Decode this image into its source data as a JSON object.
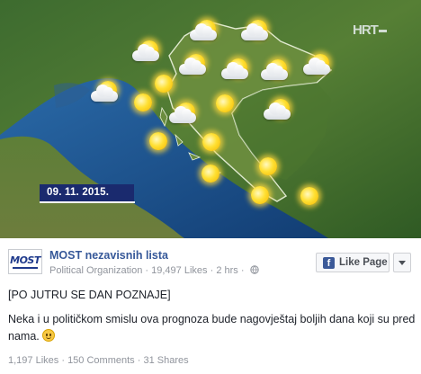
{
  "video": {
    "channel_logo": "HRT",
    "date": "09. 11. 2015."
  },
  "weather_icons": [
    {
      "type": "sun-cloud"
    },
    {
      "type": "sun-cloud"
    },
    {
      "type": "sun-cloud"
    },
    {
      "type": "sun-cloud"
    },
    {
      "type": "sun"
    },
    {
      "type": "sun-cloud"
    },
    {
      "type": "sun-cloud"
    },
    {
      "type": "sun-cloud"
    },
    {
      "type": "sun-cloud"
    },
    {
      "type": "sun"
    },
    {
      "type": "sun-cloud"
    },
    {
      "type": "sun-cloud"
    },
    {
      "type": "sun"
    },
    {
      "type": "sun"
    },
    {
      "type": "sun"
    },
    {
      "type": "sun"
    },
    {
      "type": "sun"
    },
    {
      "type": "sun"
    },
    {
      "type": "sun"
    }
  ],
  "post": {
    "page_logo_text": "MOST",
    "page_name": "MOST nezavisnih lista",
    "page_category": "Political Organization",
    "page_likes": "19,497 Likes",
    "time_ago": "2 hrs",
    "like_page_label": "Like Page",
    "title": "[PO JUTRU SE DAN POZNAJE]",
    "body": "Neka i u političkom smislu ova prognoza bude nagovještaj boljih dana koji su pred nama.",
    "likes": "1,197 Likes",
    "comments": "150 Comments",
    "shares": "31 Shares"
  },
  "colors": {
    "link_blue": "#365899",
    "facebook_blue": "#3b5998",
    "date_bar": "#1a2a6e",
    "sea": "#1c4f86",
    "land": "#3e7a2c"
  },
  "icons": [
    "globe-icon",
    "facebook-icon",
    "chevron-down-icon",
    "smile-emoji-icon",
    "sun-icon",
    "cloud-icon"
  ]
}
